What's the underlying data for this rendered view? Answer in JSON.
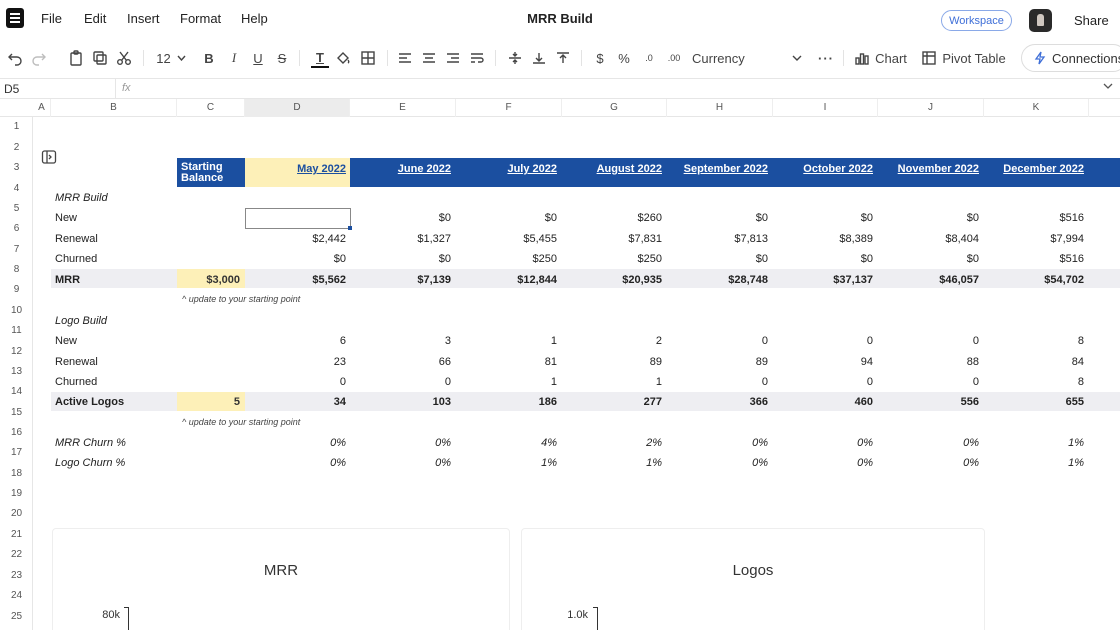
{
  "app": {
    "title": "MRR Build",
    "menu": [
      "File",
      "Edit",
      "Insert",
      "Format",
      "Help"
    ],
    "workspace_label": "Workspace",
    "share_label": "Share"
  },
  "toolbar": {
    "font_size": "12",
    "number_format": "Currency",
    "chart_label": "Chart",
    "pivot_label": "Pivot Table",
    "connections_label": "Connections",
    "more_label": "···",
    "dollar_label": "$",
    "percent_label": "%"
  },
  "formula_bar": {
    "cell_ref": "D5",
    "fx": "fx",
    "value": ""
  },
  "columns": [
    "A",
    "B",
    "C",
    "D",
    "E",
    "F",
    "G",
    "H",
    "I",
    "J",
    "K"
  ],
  "active_column": "D",
  "rows": [
    "1",
    "2",
    "3",
    "4",
    "5",
    "6",
    "7",
    "8",
    "9",
    "10",
    "11",
    "12",
    "13",
    "14",
    "15",
    "16",
    "17",
    "18",
    "19",
    "20",
    "21",
    "22",
    "23",
    "24",
    "25"
  ],
  "sheet": {
    "starting_balance_header": "Starting Balance",
    "months": [
      "May 2022",
      "June 2022",
      "July 2022",
      "August 2022",
      "September 2022",
      "October 2022",
      "November 2022",
      "December 2022"
    ],
    "mrr_build_label": "MRR Build",
    "new_label": "New",
    "renewal_label": "Renewal",
    "churned_label": "Churned",
    "mrr_label": "MRR",
    "mrr_start": "$3,000",
    "mrr_note": "^ update to your starting point",
    "mrr_new": [
      "",
      "$0",
      "$0",
      "$260",
      "$0",
      "$0",
      "$0",
      "$516"
    ],
    "mrr_renewal": [
      "$2,442",
      "$1,327",
      "$5,455",
      "$7,831",
      "$7,813",
      "$8,389",
      "$8,404",
      "$7,994"
    ],
    "mrr_churned": [
      "$0",
      "$0",
      "$250",
      "$250",
      "$0",
      "$0",
      "$0",
      "$516"
    ],
    "mrr_total": [
      "$5,562",
      "$7,139",
      "$12,844",
      "$20,935",
      "$28,748",
      "$37,137",
      "$46,057",
      "$54,702"
    ],
    "logo_build_label": "Logo Build",
    "active_logos_label": "Active Logos",
    "logos_start": "5",
    "logos_note": "^ update to your starting point",
    "logo_new": [
      "6",
      "3",
      "1",
      "2",
      "0",
      "0",
      "0",
      "8"
    ],
    "logo_renewal": [
      "23",
      "66",
      "81",
      "89",
      "89",
      "94",
      "88",
      "84"
    ],
    "logo_churned": [
      "0",
      "0",
      "1",
      "1",
      "0",
      "0",
      "0",
      "8"
    ],
    "logo_total": [
      "34",
      "103",
      "186",
      "277",
      "366",
      "460",
      "556",
      "655"
    ],
    "mrr_churn_label": "MRR Churn %",
    "logo_churn_label": "Logo Churn %",
    "mrr_churn": [
      "0%",
      "0%",
      "4%",
      "2%",
      "0%",
      "0%",
      "0%",
      "1%"
    ],
    "logo_churn": [
      "0%",
      "0%",
      "1%",
      "1%",
      "0%",
      "0%",
      "0%",
      "1%"
    ]
  },
  "charts": [
    {
      "title": "MRR",
      "y_tick_top": "80k"
    },
    {
      "title": "Logos",
      "y_tick_top": "1.0k"
    }
  ],
  "colors": {
    "header_blue": "#1b4fa0",
    "highlight_yellow": "#fdf0b8",
    "total_band": "#eeeef2"
  }
}
